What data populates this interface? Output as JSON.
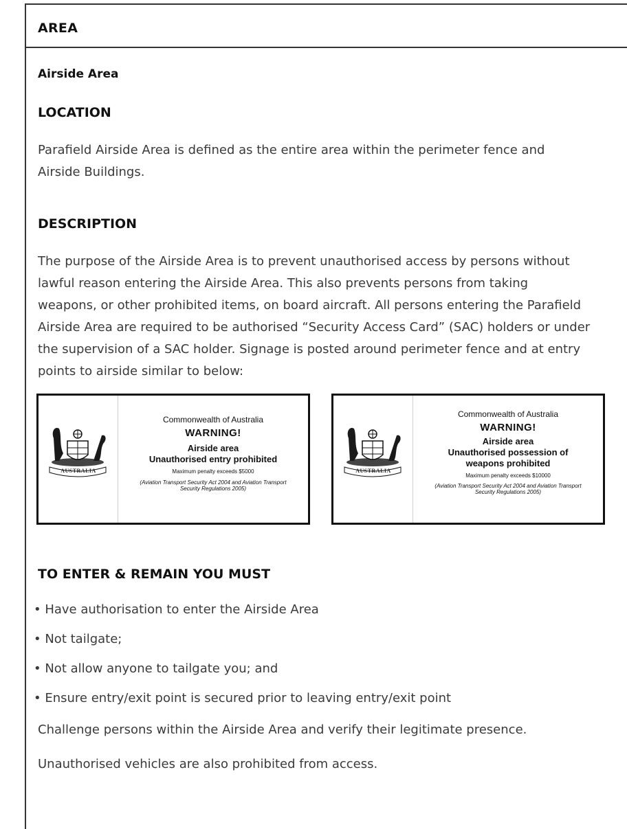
{
  "area": {
    "heading": "AREA",
    "name": "Airside Area"
  },
  "location": {
    "heading": "LOCATION",
    "text_line1": "Parafield Airside Area is defined as the entire area within the perimeter fence and",
    "text_line2": "Airside Buildings."
  },
  "description": {
    "heading": "DESCRIPTION",
    "lines": [
      "The purpose of the Airside Area is to prevent unauthorised access by persons without",
      "lawful reason entering the Airside Area. This also prevents persons from taking",
      "weapons, or other prohibited items, on board aircraft. All persons entering the Parafield",
      "Airside Area are required to be authorised “Security Access Card” (SAC) holders or under",
      "the supervision of a SAC holder. Signage is posted around perimeter fence and at entry",
      "points to airside similar to below:"
    ]
  },
  "signs": [
    {
      "emblem_text": "AUSTRALIA",
      "authority": "Commonwealth of Australia",
      "warning": "WARNING!",
      "line1": "Airside area",
      "line2": "Unauthorised entry prohibited",
      "line3": "",
      "penalty": "Maximum penalty exceeds $5000",
      "act_line1": "(Aviation Transport Security Act 2004 and Aviation Transport",
      "act_line2": "Security Regulations 2005)"
    },
    {
      "emblem_text": "AUSTRALIA",
      "authority": "Commonwealth of Australia",
      "warning": "WARNING!",
      "line1": "Airside area",
      "line2": "Unauthorised possession of",
      "line3": "weapons prohibited",
      "penalty": "Maximum penalty exceeds $10000",
      "act_line1": "(Aviation Transport Security Act 2004 and Aviation Transport",
      "act_line2": "Security Regulations 2005)"
    }
  ],
  "requirements": {
    "heading": "TO ENTER & REMAIN YOU MUST",
    "items": [
      "Have authorisation to enter the Airside Area",
      "Not tailgate;",
      "Not allow anyone to tailgate you; and",
      "Ensure entry/exit point is secured prior to leaving entry/exit point"
    ],
    "note1": "Challenge persons within the Airside Area and verify their legitimate presence.",
    "note2": "Unauthorised vehicles are also prohibited from access."
  }
}
